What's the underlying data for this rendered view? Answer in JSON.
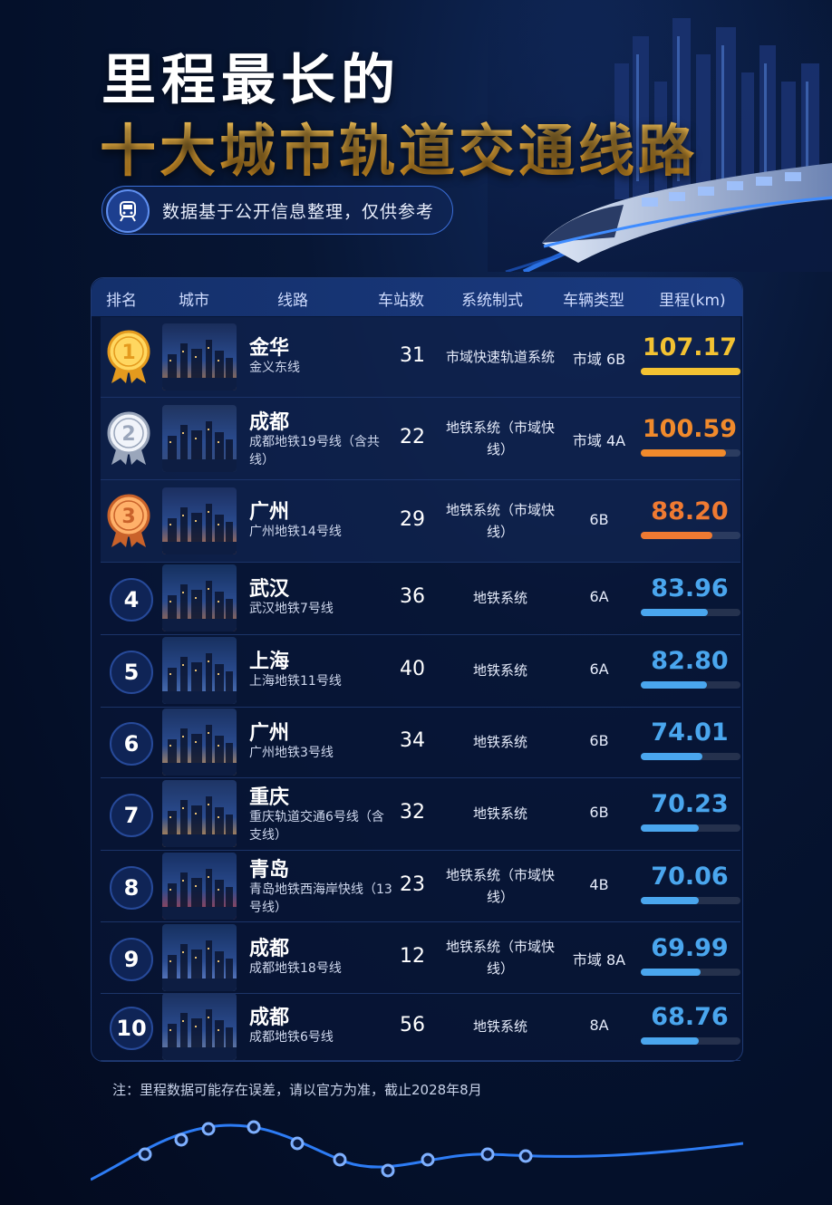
{
  "header": {
    "title_line1": "里程最长的",
    "title_line2": "十大城市轨道交通线路",
    "subtitle": "数据基于公开信息整理，仅供参考"
  },
  "table": {
    "columns": [
      "排名",
      "城市",
      "线路",
      "车站数",
      "系统制式",
      "车辆类型",
      "里程(km)"
    ],
    "rows": [
      {
        "rank": "1",
        "city": "金华",
        "line": "金义东线",
        "stations": "31",
        "system": "市域快速轨道系统",
        "vehicle": "市域 6B",
        "mileage": "107.17",
        "fraction": 1.0,
        "color": "#f3c232",
        "medal": "gold"
      },
      {
        "rank": "2",
        "city": "成都",
        "line": "成都地铁19号线（含共线）",
        "stations": "22",
        "system": "地铁系统（市域快线）",
        "vehicle": "市域 4A",
        "mileage": "100.59",
        "fraction": 0.85,
        "color": "#f08a2c",
        "medal": "silver"
      },
      {
        "rank": "3",
        "city": "广州",
        "line": "广州地铁14号线",
        "stations": "29",
        "system": "地铁系统（市域快线）",
        "vehicle": "6B",
        "mileage": "88.20",
        "fraction": 0.72,
        "color": "#ef7a32",
        "medal": "bronze"
      },
      {
        "rank": "4",
        "city": "武汉",
        "line": "武汉地铁7号线",
        "stations": "36",
        "system": "地铁系统",
        "vehicle": "6A",
        "mileage": "83.96",
        "fraction": 0.67,
        "color": "#4aa6ee",
        "medal": ""
      },
      {
        "rank": "5",
        "city": "上海",
        "line": "上海地铁11号线",
        "stations": "40",
        "system": "地铁系统",
        "vehicle": "6A",
        "mileage": "82.80",
        "fraction": 0.66,
        "color": "#4aa6ee",
        "medal": ""
      },
      {
        "rank": "6",
        "city": "广州",
        "line": "广州地铁3号线",
        "stations": "34",
        "system": "地铁系统",
        "vehicle": "6B",
        "mileage": "74.01",
        "fraction": 0.62,
        "color": "#4aa6ee",
        "medal": ""
      },
      {
        "rank": "7",
        "city": "重庆",
        "line": "重庆轨道交通6号线（含支线）",
        "stations": "32",
        "system": "地铁系统",
        "vehicle": "6B",
        "mileage": "70.23",
        "fraction": 0.58,
        "color": "#4aa6ee",
        "medal": ""
      },
      {
        "rank": "8",
        "city": "青岛",
        "line": "青岛地铁西海岸快线（13号线）",
        "stations": "23",
        "system": "地铁系统（市域快线）",
        "vehicle": "4B",
        "mileage": "70.06",
        "fraction": 0.58,
        "color": "#4aa6ee",
        "medal": ""
      },
      {
        "rank": "9",
        "city": "成都",
        "line": "成都地铁18号线",
        "stations": "12",
        "system": "地铁系统（市域快线）",
        "vehicle": "市域 8A",
        "mileage": "69.99",
        "fraction": 0.6,
        "color": "#4aa6ee",
        "medal": ""
      },
      {
        "rank": "10",
        "city": "成都",
        "line": "成都地铁6号线",
        "stations": "56",
        "system": "地铁系统",
        "vehicle": "8A",
        "mileage": "68.76",
        "fraction": 0.58,
        "color": "#4aa6ee",
        "medal": ""
      }
    ]
  },
  "footnote": "注：里程数据可能存在误差，请以官方为准，截止2028年8月"
}
